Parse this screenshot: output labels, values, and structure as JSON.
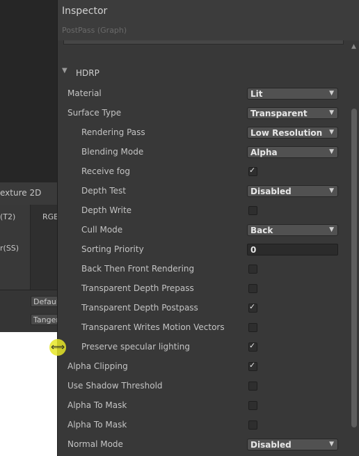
{
  "graph_fragments": {
    "node_title": "exture 2D",
    "port_t2": "(T2)",
    "port_rgb": "RGB",
    "port_ss": "r(SS)",
    "default_button": "Default",
    "tangent_button": "Tangent"
  },
  "inspector": {
    "title": "Inspector",
    "subtitle": "PostPass (Graph)",
    "section": "HDRP",
    "rows": [
      {
        "label": "Material",
        "type": "dropdown",
        "value": "Lit",
        "indent": false
      },
      {
        "label": "Surface Type",
        "type": "dropdown",
        "value": "Transparent",
        "indent": false
      },
      {
        "label": "Rendering Pass",
        "type": "dropdown",
        "value": "Low Resolution",
        "indent": true
      },
      {
        "label": "Blending Mode",
        "type": "dropdown",
        "value": "Alpha",
        "indent": true
      },
      {
        "label": "Receive fog",
        "type": "checkbox",
        "checked": true,
        "indent": true
      },
      {
        "label": "Depth Test",
        "type": "dropdown",
        "value": "Disabled",
        "indent": true
      },
      {
        "label": "Depth Write",
        "type": "checkbox",
        "checked": false,
        "indent": true
      },
      {
        "label": "Cull Mode",
        "type": "dropdown",
        "value": "Back",
        "indent": true
      },
      {
        "label": "Sorting Priority",
        "type": "number",
        "value": "0",
        "indent": true
      },
      {
        "label": "Back Then Front Rendering",
        "type": "checkbox",
        "checked": false,
        "indent": true
      },
      {
        "label": "Transparent Depth Prepass",
        "type": "checkbox",
        "checked": false,
        "indent": true
      },
      {
        "label": "Transparent Depth Postpass",
        "type": "checkbox",
        "checked": true,
        "indent": true
      },
      {
        "label": "Transparent Writes Motion Vectors",
        "type": "checkbox",
        "checked": false,
        "indent": true
      },
      {
        "label": "Preserve specular lighting",
        "type": "checkbox",
        "checked": true,
        "indent": true
      },
      {
        "label": "Alpha Clipping",
        "type": "checkbox",
        "checked": true,
        "indent": false
      },
      {
        "label": "Use Shadow Threshold",
        "type": "checkbox",
        "checked": false,
        "indent": false
      },
      {
        "label": "Alpha To Mask",
        "type": "checkbox",
        "checked": false,
        "indent": false
      },
      {
        "label": "Alpha To Mask",
        "type": "checkbox",
        "checked": false,
        "indent": false
      },
      {
        "label": "Normal Mode",
        "type": "dropdown",
        "value": "Disabled",
        "indent": false
      }
    ]
  },
  "icons": {
    "foldout": "triangle-down-icon",
    "dropdown_arrow": "triangle-down-icon",
    "check": "checkmark-icon",
    "cursor": "resize-horizontal-icon"
  }
}
